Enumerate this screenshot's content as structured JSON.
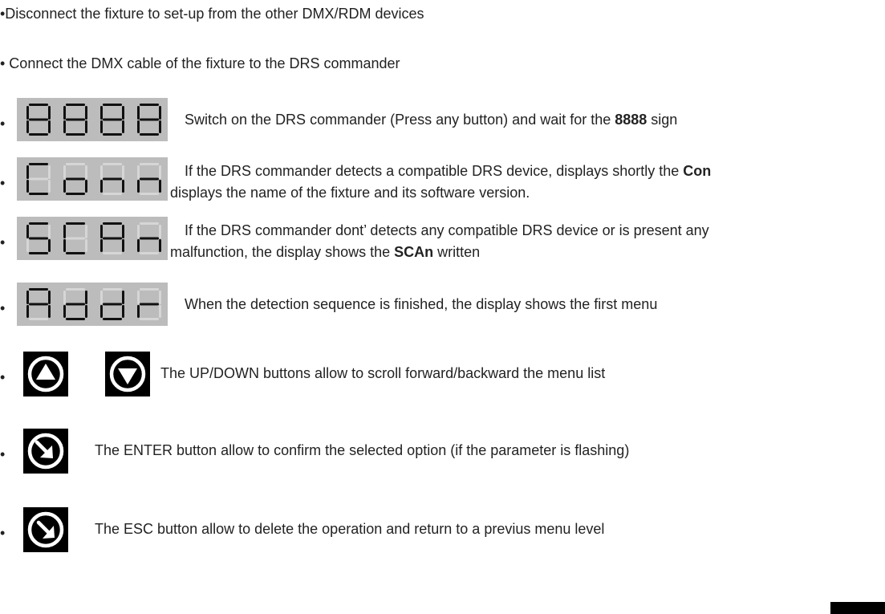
{
  "intro": [
    "•Disconnect the fixture to set-up from the other DMX/RDM devices",
    "• Connect the DMX cable of the fixture to the DRS commander"
  ],
  "bullet_char": "•",
  "display_rows": [
    {
      "display_text": "8888",
      "line1_before": "Switch on the DRS commander (Press any button) and wait for the ",
      "line1_bold": "8888",
      "line1_after": " sign",
      "line2_before": "",
      "line2_bold": "",
      "line2_after": ""
    },
    {
      "display_text": "Conn",
      "line1_before": "If the DRS commander detects a compatible DRS device, displays shortly the ",
      "line1_bold": "Con",
      "line1_after": "",
      "line2_before": "displays the name of the fixture and its software version.",
      "line2_bold": "",
      "line2_after": ""
    },
    {
      "display_text": "SCAn",
      "line1_before": "If the DRS commander dont’ detects any compatible DRS device or is present any",
      "line1_bold": "",
      "line1_after": "",
      "line2_before": "malfunction, the display shows the ",
      "line2_bold": "SCAn",
      "line2_after": " written"
    },
    {
      "display_text": "Addr",
      "line1_before": "When the detection sequence is finished, the display shows the first menu",
      "line1_bold": "",
      "line1_after": "",
      "line2_before": "",
      "line2_bold": "",
      "line2_after": ""
    }
  ],
  "button_rows": [
    {
      "icons": [
        "up-arrow-button-icon",
        "down-arrow-button-icon"
      ],
      "text": "The UP/DOWN buttons allow to scroll forward/backward the menu list"
    },
    {
      "icons": [
        "enter-button-icon"
      ],
      "text": "The ENTER button allow to confirm the selected option (if the parameter is flashing)"
    },
    {
      "icons": [
        "esc-button-icon"
      ],
      "text": "The ESC button allow to delete the operation and return to a previus menu level"
    }
  ],
  "colors": {
    "display_bg": "#bcbcbc",
    "segment_on": "#111111",
    "segment_off": "#d6d6d6",
    "button_bg": "#000000"
  }
}
